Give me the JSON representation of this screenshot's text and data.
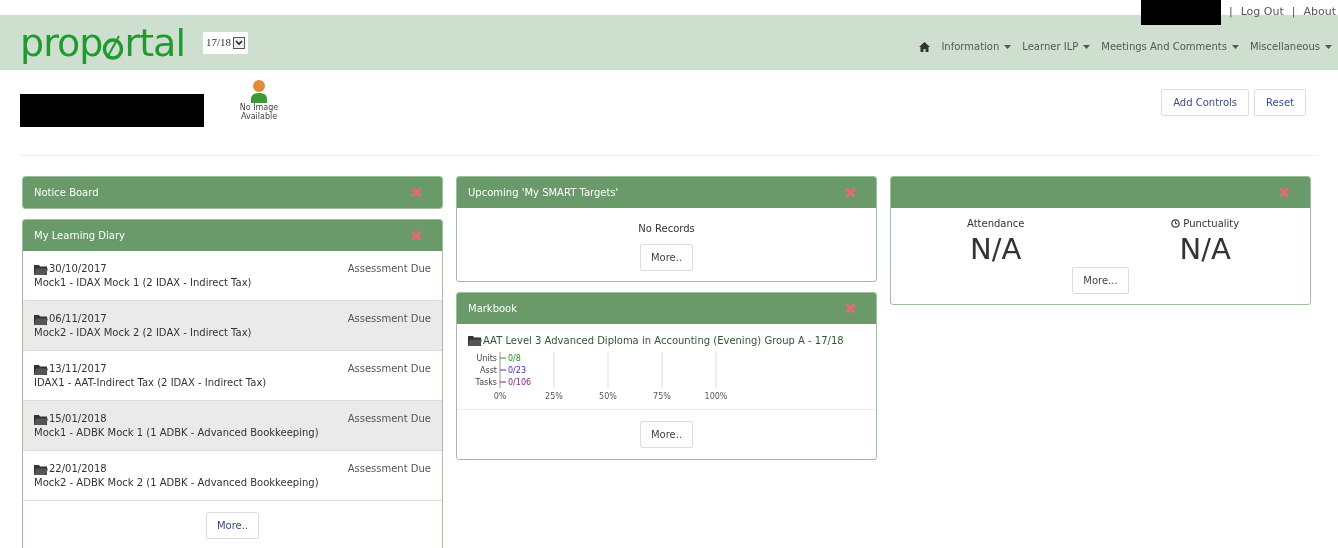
{
  "header": {
    "logo": "prop",
    "logo_rest": "rtal",
    "year_select": {
      "value": "17/18"
    },
    "top_links": [
      "|",
      "Log Out",
      "|",
      "About"
    ],
    "nav": [
      {
        "label": "Information"
      },
      {
        "label": "Learner ILP"
      },
      {
        "label": "Meetings And Comments"
      },
      {
        "label": "Miscellaneous"
      }
    ]
  },
  "profile": {
    "photo_caption": "No Image Available"
  },
  "toolbar": {
    "buttons": [
      "Add Controls",
      "Reset"
    ]
  },
  "notice_board": {
    "title": "Notice Board"
  },
  "learning_diary": {
    "title": "My Learning Diary",
    "items": [
      {
        "date": "30/10/2017",
        "status": "Assessment Due",
        "description": "Mock1 - IDAX Mock 1 (2 IDAX - Indirect Tax)"
      },
      {
        "date": "06/11/2017",
        "status": "Assessment Due",
        "description": "Mock2 - IDAX Mock 2 (2 IDAX - Indirect Tax)"
      },
      {
        "date": "13/11/2017",
        "status": "Assessment Due",
        "description": "IDAX1 - AAT-Indirect Tax (2 IDAX - Indirect Tax)"
      },
      {
        "date": "15/01/2018",
        "status": "Assessment Due",
        "description": "Mock1 - ADBK Mock 1 (1 ADBK - Advanced Bookkeeping)"
      },
      {
        "date": "22/01/2018",
        "status": "Assessment Due",
        "description": "Mock2 - ADBK Mock 2 (1 ADBK - Advanced Bookkeeping)"
      }
    ],
    "more": "More.."
  },
  "smart_targets": {
    "title": "Upcoming 'My SMART Targets'",
    "message": "No Records",
    "more": "More.."
  },
  "markbook": {
    "title": "Markbook",
    "course": "AAT Level 3 Advanced Diploma in Accounting (Evening) Group A - 17/18",
    "chart_data": {
      "type": "bar",
      "orientation": "horizontal",
      "grid": true,
      "categories": [
        "Units",
        "Asst",
        "Tasks"
      ],
      "series": [
        {
          "color": "#2e8b2e",
          "values": [
            0,
            null,
            null
          ]
        },
        {
          "color": "#3333cc",
          "values": [
            null,
            0,
            null
          ]
        },
        {
          "color": "#882288",
          "values": [
            null,
            null,
            0
          ]
        }
      ],
      "xlim": [
        0,
        100
      ],
      "xticks": [
        {
          "value": 0,
          "label": "0%"
        },
        {
          "value": 25,
          "label": "25%"
        },
        {
          "value": 50,
          "label": "50%"
        },
        {
          "value": 75,
          "label": "75%"
        },
        {
          "value": 100,
          "label": "100%"
        }
      ],
      "value_labels": [
        "0/8",
        "0/23",
        "0/106"
      ]
    },
    "more": "More.."
  },
  "attendance_panel": {
    "stats": [
      {
        "kind": "plain",
        "label": "Attendance",
        "value": "N/A"
      },
      {
        "kind": "timed",
        "label": "Punctuality",
        "value": "N/A"
      }
    ],
    "more": "More..."
  }
}
